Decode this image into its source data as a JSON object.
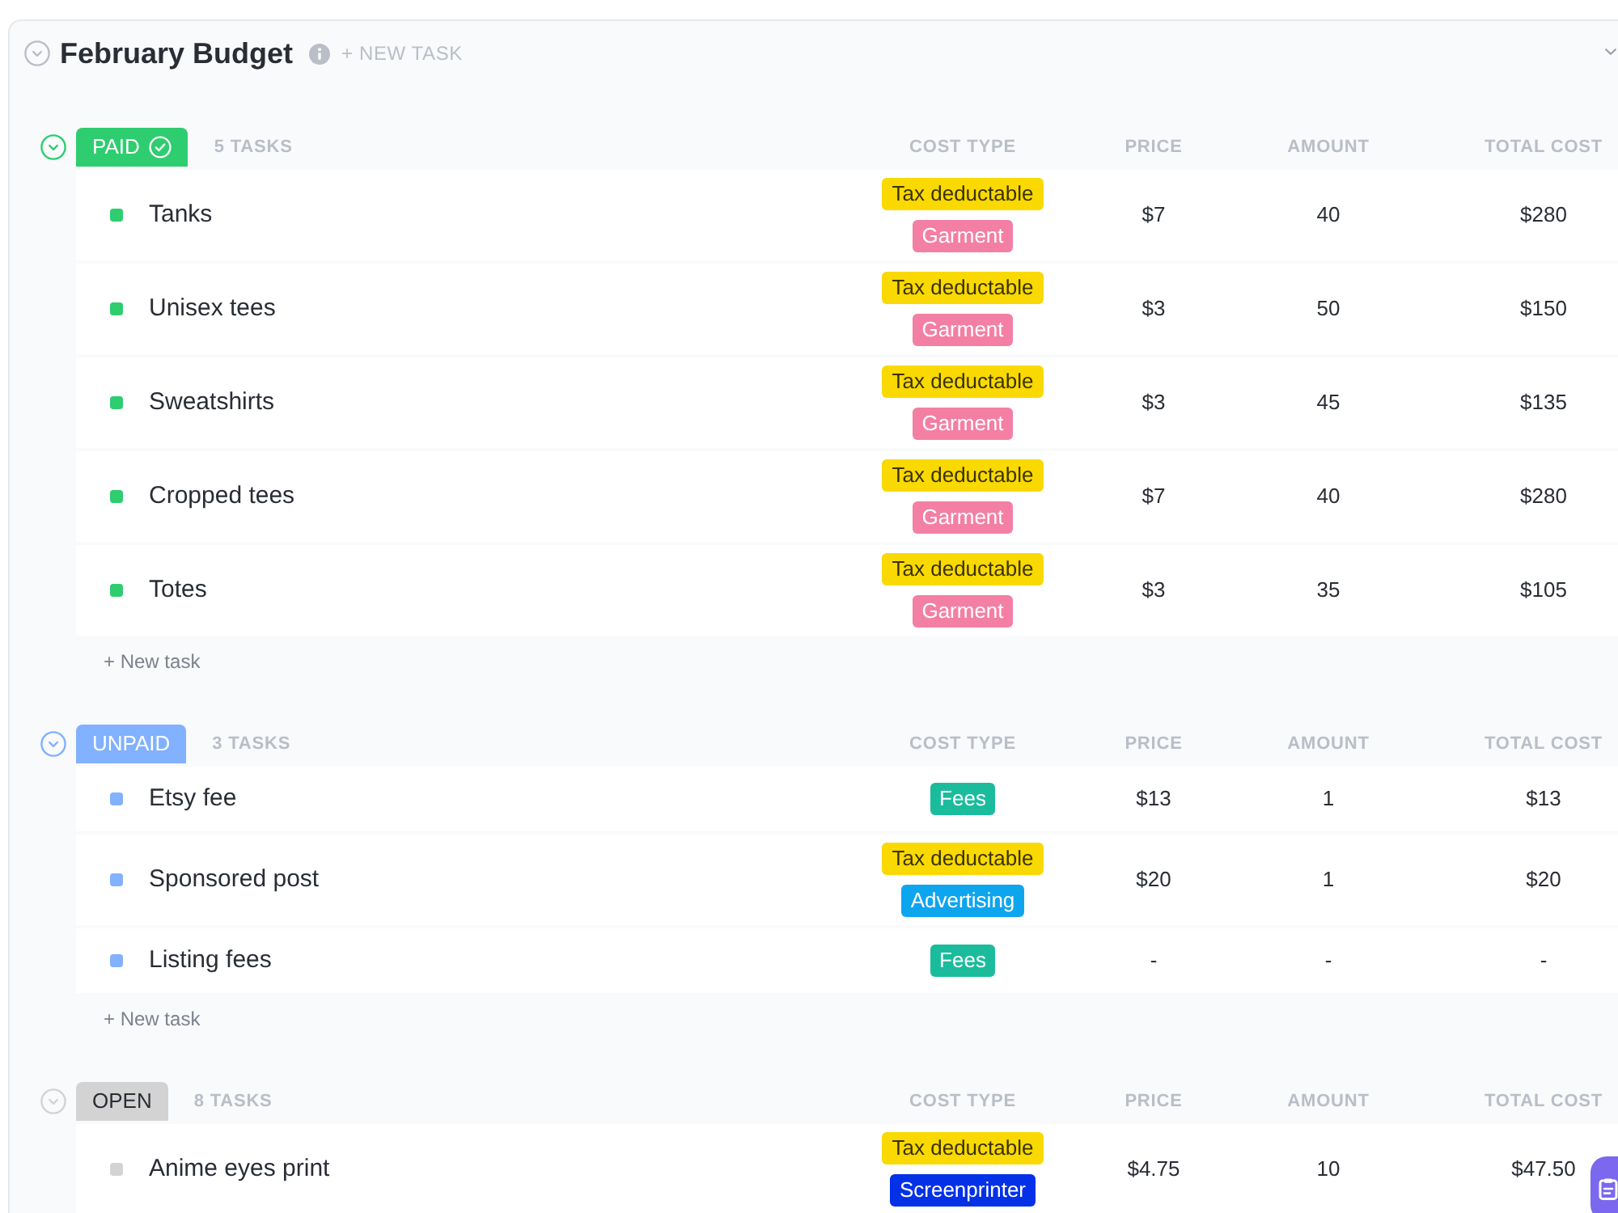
{
  "list": {
    "title": "February Budget",
    "new_task_label": "+ NEW TASK"
  },
  "groups": [
    {
      "status": "PAID",
      "color": "#2ecd6f",
      "closed": true,
      "task_count": "5 TASKS",
      "columns": [
        "COST TYPE",
        "PRICE",
        "AMOUNT",
        "TOTAL COST"
      ],
      "tasks": [
        {
          "name": "Tanks",
          "tags": [
            {
              "label": "Tax deductable",
              "color": "#f9d900"
            },
            {
              "label": "Garment",
              "color": "#f47fa4"
            }
          ],
          "price": "$7",
          "amount": "40",
          "total_cost": "$280"
        },
        {
          "name": "Unisex tees",
          "tags": [
            {
              "label": "Tax deductable",
              "color": "#f9d900"
            },
            {
              "label": "Garment",
              "color": "#f47fa4"
            }
          ],
          "price": "$3",
          "amount": "50",
          "total_cost": "$150"
        },
        {
          "name": "Sweatshirts",
          "tags": [
            {
              "label": "Tax deductable",
              "color": "#f9d900"
            },
            {
              "label": "Garment",
              "color": "#f47fa4"
            }
          ],
          "price": "$3",
          "amount": "45",
          "total_cost": "$135"
        },
        {
          "name": "Cropped tees",
          "tags": [
            {
              "label": "Tax deductable",
              "color": "#f9d900"
            },
            {
              "label": "Garment",
              "color": "#f47fa4"
            }
          ],
          "price": "$7",
          "amount": "40",
          "total_cost": "$280"
        },
        {
          "name": "Totes",
          "tags": [
            {
              "label": "Tax deductable",
              "color": "#f9d900"
            },
            {
              "label": "Garment",
              "color": "#f47fa4"
            }
          ],
          "price": "$3",
          "amount": "35",
          "total_cost": "$105"
        }
      ],
      "new_task_label": "+ New task"
    },
    {
      "status": "UNPAID",
      "color": "#81b1ff",
      "closed": false,
      "task_count": "3 TASKS",
      "columns": [
        "COST TYPE",
        "PRICE",
        "AMOUNT",
        "TOTAL COST"
      ],
      "tasks": [
        {
          "name": "Etsy fee",
          "tags": [
            {
              "label": "Fees",
              "color": "#1bbc9c"
            }
          ],
          "price": "$13",
          "amount": "1",
          "total_cost": "$13"
        },
        {
          "name": "Sponsored post",
          "tags": [
            {
              "label": "Tax deductable",
              "color": "#f9d900"
            },
            {
              "label": "Advertising",
              "color": "#0ea5ef"
            }
          ],
          "price": "$20",
          "amount": "1",
          "total_cost": "$20"
        },
        {
          "name": "Listing fees",
          "tags": [
            {
              "label": "Fees",
              "color": "#1bbc9c"
            }
          ],
          "price": "-",
          "amount": "-",
          "total_cost": "-"
        }
      ],
      "new_task_label": "+ New task"
    },
    {
      "status": "OPEN",
      "color": "#d3d3d3",
      "closed": false,
      "task_count": "8 TASKS",
      "columns": [
        "COST TYPE",
        "PRICE",
        "AMOUNT",
        "TOTAL COST"
      ],
      "tasks": [
        {
          "name": "Anime eyes print",
          "tags": [
            {
              "label": "Tax deductable",
              "color": "#f9d900"
            },
            {
              "label": "Screenprinter",
              "color": "#0231e8"
            }
          ],
          "price": "$4.75",
          "amount": "10",
          "total_cost": "$47.50"
        }
      ]
    }
  ]
}
